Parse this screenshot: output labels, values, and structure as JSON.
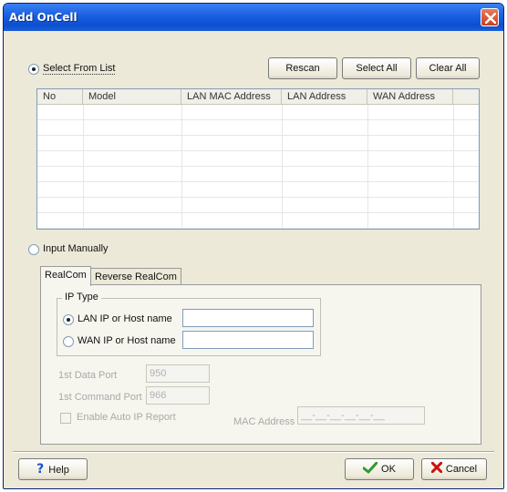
{
  "window": {
    "title": "Add OnCell"
  },
  "select_from_list": {
    "label": "Select From List",
    "selected": true,
    "buttons": {
      "rescan": "Rescan",
      "select_all": "Select All",
      "clear_all": "Clear All"
    }
  },
  "table": {
    "columns": [
      "No",
      "Model",
      "LAN MAC Address",
      "LAN Address",
      "WAN Address"
    ],
    "rows": []
  },
  "input_manually": {
    "label": "Input Manually",
    "selected": false
  },
  "tabs": [
    "RealCom",
    "Reverse RealCom"
  ],
  "ip_type": {
    "legend": "IP Type",
    "lan_label": "LAN IP or Host name",
    "lan_selected": true,
    "lan_value": "",
    "wan_label": "WAN IP or Host name",
    "wan_selected": false,
    "wan_value": ""
  },
  "ports": {
    "data_port_label": "1st Data Port",
    "data_port_value": "950",
    "command_port_label": "1st Command Port",
    "command_port_value": "966"
  },
  "auto_ip": {
    "label": "Enable Auto IP Report",
    "checked": false
  },
  "mac": {
    "label": "MAC Address",
    "placeholder": "__-__-__-__-__-__"
  },
  "footer": {
    "help": "Help",
    "ok": "OK",
    "cancel": "Cancel"
  },
  "icons": {
    "close": "close-icon",
    "help": "question-icon",
    "ok": "checkmark-icon",
    "cancel": "x-icon"
  },
  "colors": {
    "title_bar": "#0d4fd0",
    "ok_check": "#2e9a2e",
    "cancel_x": "#cc1111",
    "help_question": "#1f4fd1"
  }
}
